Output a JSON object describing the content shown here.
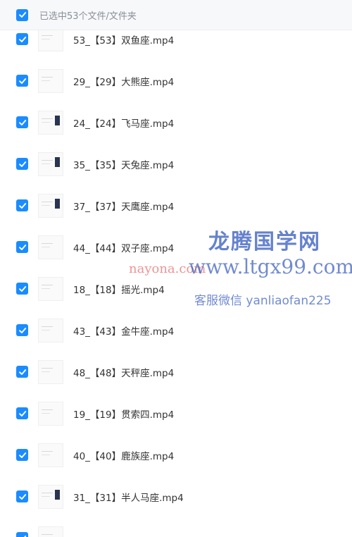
{
  "header": {
    "selection_label": "已选中53个文件/文件夹"
  },
  "files": [
    {
      "name": "53_【53】双鱼座.mp4",
      "thumb": "light"
    },
    {
      "name": "29_【29】大熊座.mp4",
      "thumb": "light"
    },
    {
      "name": "24_【24】飞马座.mp4",
      "thumb": "dark"
    },
    {
      "name": "35_【35】天兔座.mp4",
      "thumb": "dark"
    },
    {
      "name": "37_【37】天鹰座.mp4",
      "thumb": "dark"
    },
    {
      "name": "44_【44】双子座.mp4",
      "thumb": "light"
    },
    {
      "name": "18_【18】摇光.mp4",
      "thumb": "light"
    },
    {
      "name": "43_【43】金牛座.mp4",
      "thumb": "light"
    },
    {
      "name": "48_【48】天秤座.mp4",
      "thumb": "light"
    },
    {
      "name": "19_【19】贯索四.mp4",
      "thumb": "light"
    },
    {
      "name": "40_【40】鹿族座.mp4",
      "thumb": "light"
    },
    {
      "name": "31_【31】半人马座.mp4",
      "thumb": "dark"
    },
    {
      "name": "",
      "thumb": "light"
    }
  ],
  "watermark": {
    "title": "龙腾国学网",
    "site": "www.ltgx99.com",
    "contact": "客服微信 yanliaofan225",
    "overlay": "nayona.com"
  },
  "colors": {
    "accent": "#1a8cff",
    "watermark": "#3b5fbf",
    "overlay": "#e03b3b"
  }
}
